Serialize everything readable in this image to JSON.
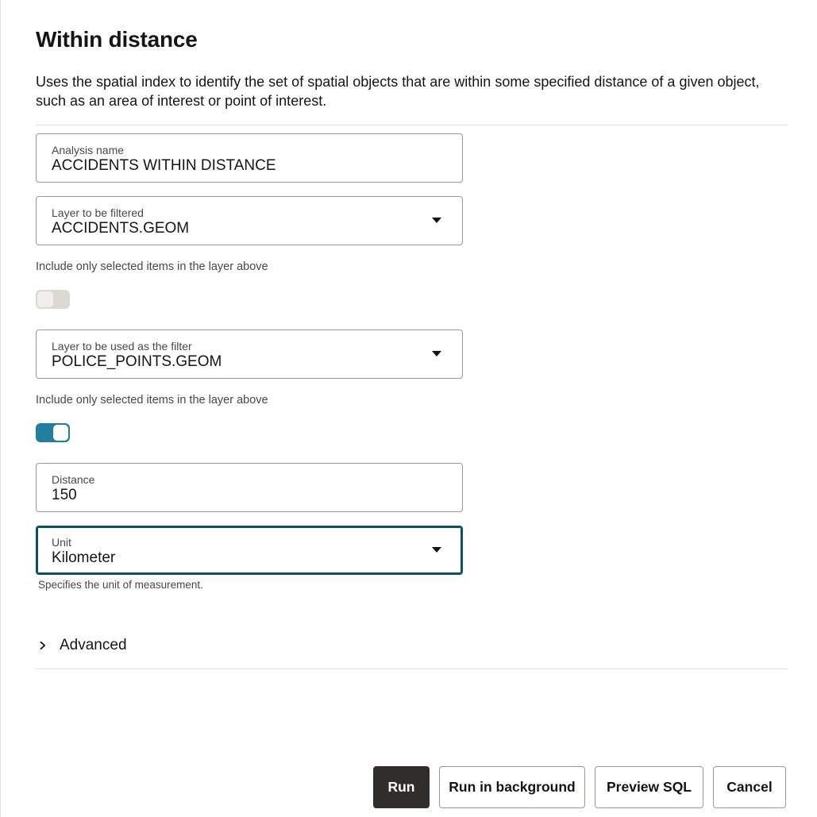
{
  "panel": {
    "title": "Within distance",
    "description": "Uses the spatial index to identify the set of spatial objects that are within some specified distance of a given object, such as an area of interest or point of interest."
  },
  "form": {
    "analysis_name": {
      "label": "Analysis name",
      "value": "ACCIDENTS WITHIN DISTANCE"
    },
    "layer_filtered": {
      "label": "Layer to be filtered",
      "value": "ACCIDENTS.GEOM",
      "icon": "caret-down-icon"
    },
    "include_selected_1": {
      "label": "Include only selected items in the layer above",
      "checked": false
    },
    "layer_filter": {
      "label": "Layer to be used as the filter",
      "value": "POLICE_POINTS.GEOM",
      "icon": "caret-down-icon"
    },
    "include_selected_2": {
      "label": "Include only selected items in the layer above",
      "checked": true
    },
    "distance": {
      "label": "Distance",
      "value": "150"
    },
    "unit": {
      "label": "Unit",
      "value": "Kilometer",
      "help": "Specifies the unit of measurement.",
      "icon": "caret-down-icon"
    },
    "advanced": {
      "label": "Advanced",
      "icon": "chevron-right-icon"
    }
  },
  "footer": {
    "run": "Run",
    "run_background": "Run in background",
    "preview_sql": "Preview SQL",
    "cancel": "Cancel"
  },
  "colors": {
    "accent": "#227e9e",
    "primary_button": "#312d2a",
    "border": "#9e9892",
    "focus_border": "#0f4e67"
  }
}
